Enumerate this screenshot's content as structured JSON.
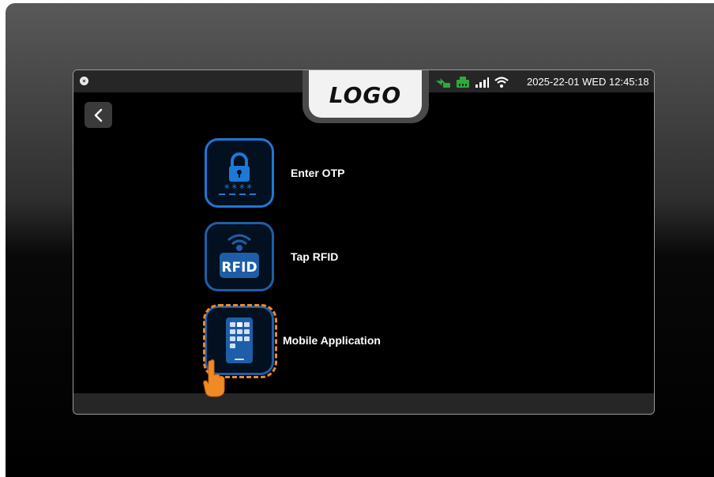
{
  "header": {
    "logo_text": "LOGO",
    "datetime": "2025-22-01 WED 12:45:18",
    "status_icons": [
      "ev-charging-icon",
      "network-icon",
      "signal-icon",
      "wifi-icon"
    ],
    "status_color": "#2eaa3c"
  },
  "nav": {
    "back_icon": "chevron-left-icon"
  },
  "options": [
    {
      "label": "Enter OTP",
      "icon": "lock-otp-icon"
    },
    {
      "label": "Tap RFID",
      "icon": "rfid-icon",
      "icon_text": "RFID"
    },
    {
      "label": "Mobile Application",
      "icon": "mobile-app-icon",
      "selected": true
    }
  ],
  "colors": {
    "accent_blue": "#1e78d6",
    "highlight_orange": "#f08a24"
  }
}
